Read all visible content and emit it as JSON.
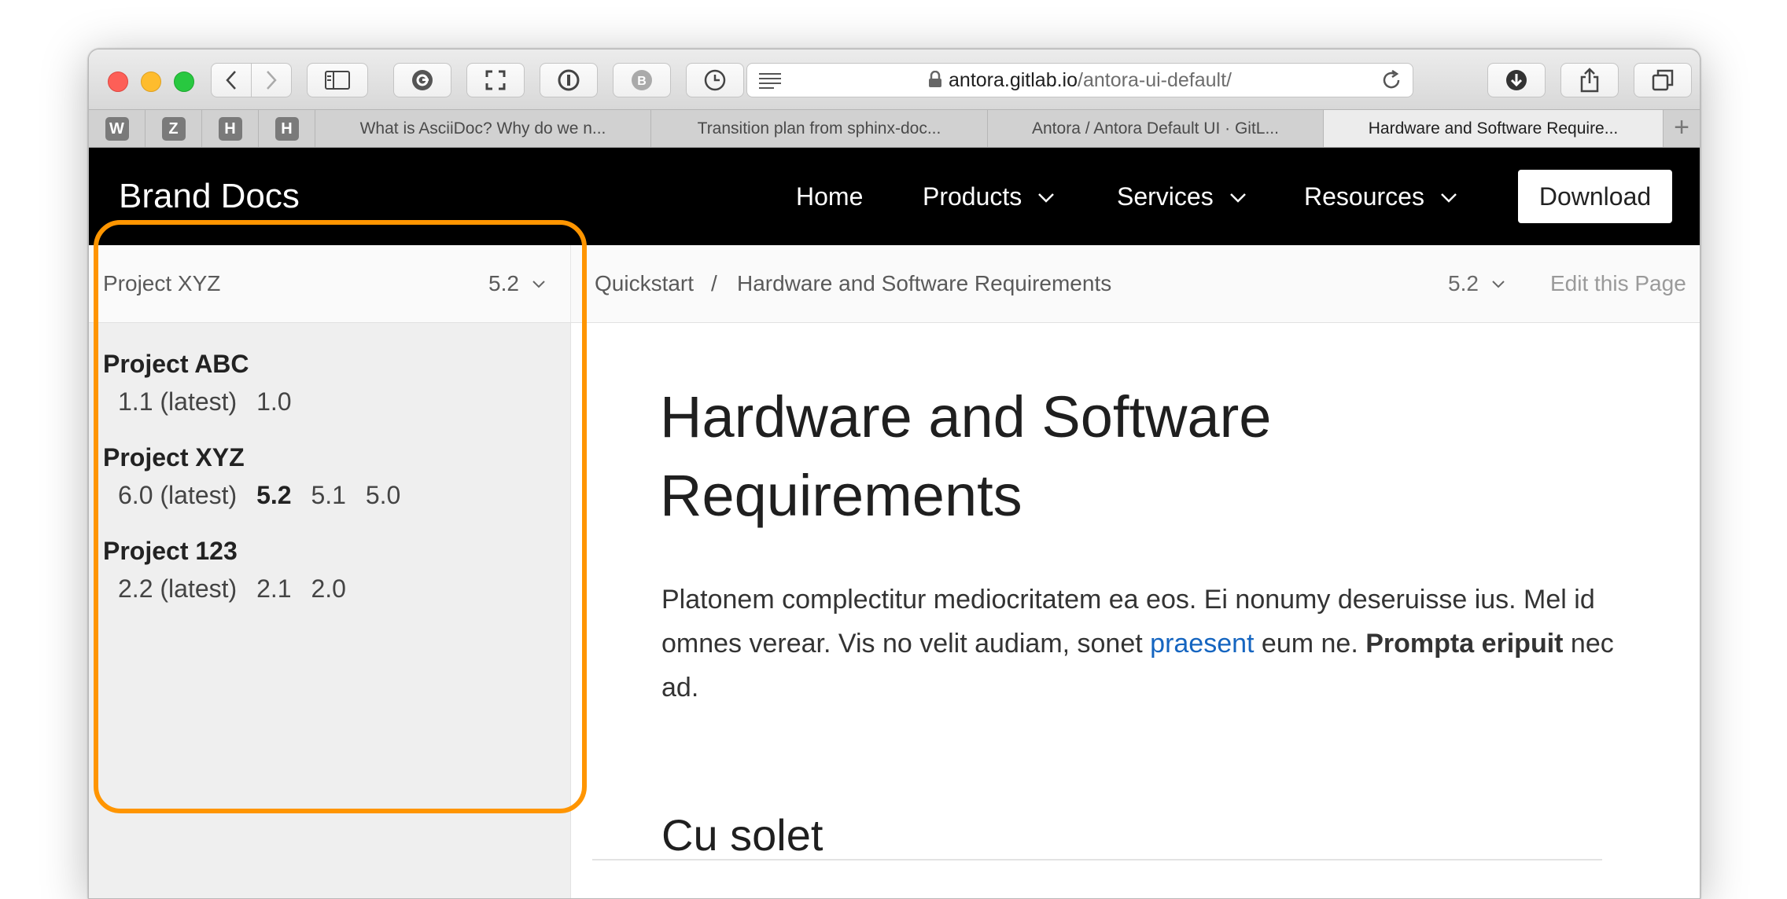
{
  "browser": {
    "url_host": "antora.gitlab.io",
    "url_path": "/antora-ui-default/",
    "pinned_tabs": [
      "W",
      "Z",
      "H",
      "H"
    ],
    "tabs": [
      {
        "label": "What is AsciiDoc? Why do we n..."
      },
      {
        "label": "Transition plan from sphinx-doc..."
      },
      {
        "label": "Antora / Antora Default UI · GitL..."
      },
      {
        "label": "Hardware and Software Require..."
      }
    ],
    "new_tab_label": "+"
  },
  "site": {
    "brand": "Brand Docs",
    "nav": [
      "Home",
      "Products",
      "Services",
      "Resources"
    ],
    "download": "Download"
  },
  "toolbar": {
    "project": "Project XYZ",
    "project_version": "5.2",
    "breadcrumbs": [
      "Quickstart",
      "Hardware and Software Requirements"
    ],
    "separator": "/",
    "page_version": "5.2",
    "edit": "Edit this Page"
  },
  "sidebar": {
    "projects": [
      {
        "name": "Project ABC",
        "versions": [
          "1.1 (latest)",
          "1.0"
        ]
      },
      {
        "name": "Project XYZ",
        "versions": [
          "6.0 (latest)",
          "5.2",
          "5.1",
          "5.0"
        ],
        "current": "5.2"
      },
      {
        "name": "Project 123",
        "versions": [
          "2.2 (latest)",
          "2.1",
          "2.0"
        ]
      }
    ]
  },
  "article": {
    "title_line1": "Hardware and Software",
    "title_line2": "Requirements",
    "para_a": "Platonem complectitur mediocritatem ea eos. Ei nonumy deseruisse ius. Mel id omnes verear. Vis no velit audiam, sonet ",
    "para_link": "praesent",
    "para_b": " eum ne. ",
    "para_bold": "Prompta eripuit",
    "para_c": " nec ad.",
    "h2": "Cu solet"
  },
  "colors": {
    "highlight": "#ff9500",
    "link": "#1565c0",
    "navbar": "#000000"
  }
}
